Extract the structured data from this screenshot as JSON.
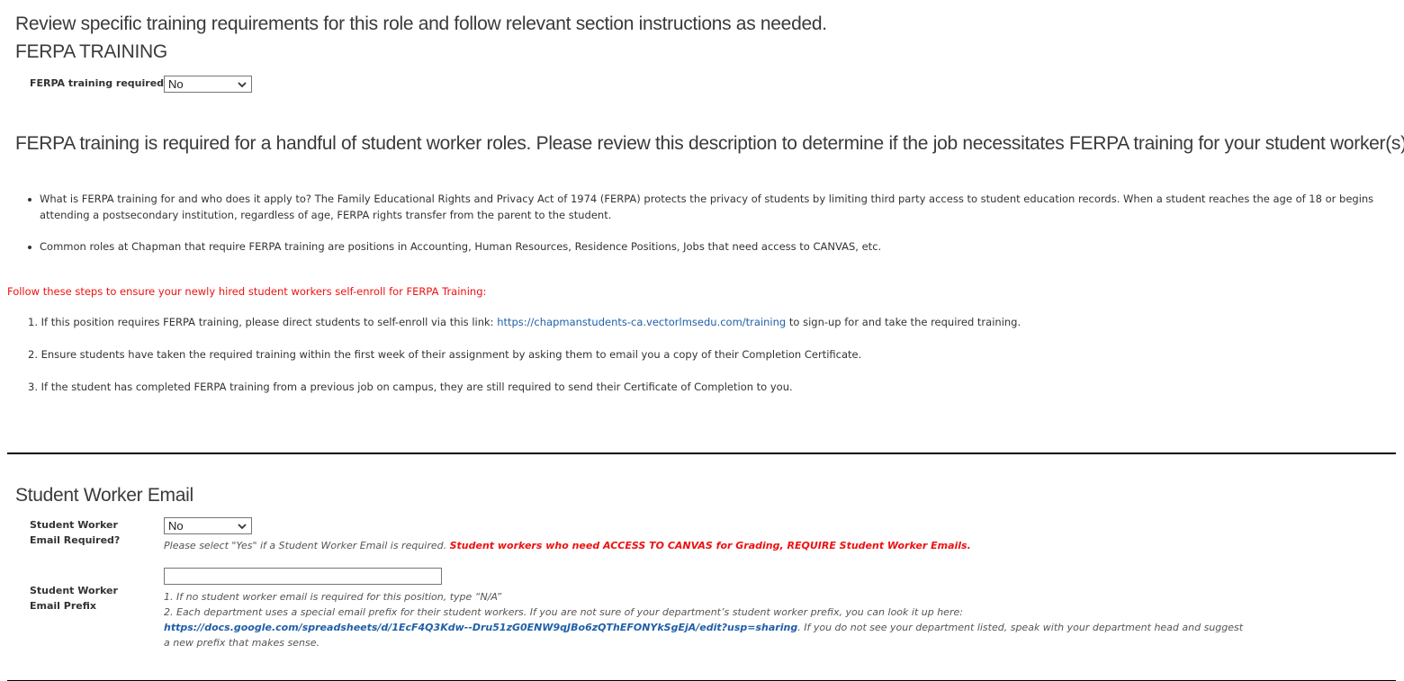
{
  "intro": "Review specific training requirements for this role and follow relevant section instructions as needed.",
  "ferpa": {
    "heading": "FERPA TRAINING",
    "field_label": "FERPA training required?",
    "select_value": "No",
    "description": "FERPA training is required for a handful of student worker roles. Please review this description to determine if the job necessitates FERPA training for your student worker(s).",
    "bullets": [
      "What is FERPA training for and who does it apply to? The Family Educational Rights and Privacy Act of 1974 (FERPA) protects the privacy of students by limiting third party access to student education records. When a student reaches the age of 18 or begins attending a postsecondary institution, regardless of age, FERPA rights transfer from the parent to the student.",
      "Common roles at Chapman that require FERPA training are positions in Accounting, Human Resources, Residence Positions, Jobs that need access to CANVAS, etc."
    ],
    "steps_title": "Follow these steps to ensure your newly hired student workers self-enroll for FERPA Training:",
    "steps": [
      {
        "before": "1. If this position requires FERPA training, please direct students to self-enroll via this link: ",
        "link": "https://chapmanstudents-ca.vectorlmsedu.com/training",
        "after": " to sign-up for and take the required training."
      },
      {
        "text": "2. Ensure students have taken the required training within the first week of their assignment by asking them to email you a copy of their Completion Certificate."
      },
      {
        "text": "3. If the student has completed FERPA training from a previous job on campus, they are still required to send their Certificate of Completion to you."
      }
    ]
  },
  "email": {
    "heading": "Student Worker Email",
    "required_label": "Student Worker Email Required?",
    "required_value": "No",
    "help_text": "Please select \"Yes\" if a Student Worker Email is required. ",
    "help_warning": "Student workers who need ACCESS TO CANVAS for Grading, REQUIRE Student Worker Emails.",
    "prefix_label": "Student Worker Email Prefix",
    "prefix_value": "",
    "prefix_help_1": "1. If no student worker email is required for this position, type “N/A”",
    "prefix_help_2_before": "2. Each department uses a special email prefix for their student workers. If you are not sure of your department’s student worker prefix, you can look it up here: ",
    "prefix_help_2_link": "https://docs.google.com/spreadsheets/d/1EcF4Q3Kdw--Dru51zG0ENW9qJBo6zQThEFONYkSgEjA/edit?usp=sharing",
    "prefix_help_2_after": ". If you do not see your department listed, speak with your department head and suggest a new prefix that makes sense."
  },
  "icons": {
    "select_chevron": "chevron-down-icon"
  }
}
